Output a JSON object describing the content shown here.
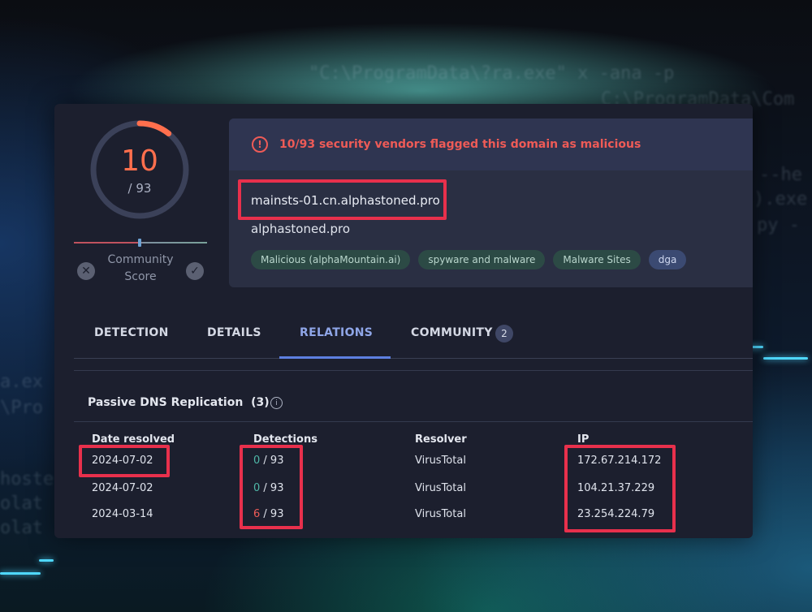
{
  "score": {
    "detected": "10",
    "total_label": "/ 93",
    "detected_count": 10,
    "total_count": 93
  },
  "community": {
    "label_line1": "Community",
    "label_line2": "Score",
    "negative_icon": "close-icon",
    "positive_icon": "check-icon"
  },
  "alert": {
    "icon": "alert-circle-icon",
    "text": "10/93 security vendors flagged this domain as malicious"
  },
  "domain": {
    "name": "mainsts-01.cn.alphastoned.pro",
    "parent": "alphastoned.pro"
  },
  "tags": [
    {
      "label": "Malicious (alphaMountain.ai)"
    },
    {
      "label": "spyware and malware"
    },
    {
      "label": "Malware Sites"
    },
    {
      "label": "dga"
    }
  ],
  "tabs": [
    {
      "label": "DETECTION"
    },
    {
      "label": "DETAILS"
    },
    {
      "label": "RELATIONS"
    },
    {
      "label": "COMMUNITY",
      "badge": "2"
    }
  ],
  "active_tab": "RELATIONS",
  "passive_dns": {
    "title": "Passive DNS Replication",
    "count": "(3)",
    "columns": [
      "Date resolved",
      "Detections",
      "Resolver",
      "IP"
    ],
    "rows": [
      {
        "date": "2024-07-02",
        "det": "0",
        "det_total": "/ 93",
        "resolver": "VirusTotal",
        "ip": "172.67.214.172"
      },
      {
        "date": "2024-07-02",
        "det": "0",
        "det_total": "/ 93",
        "resolver": "VirusTotal",
        "ip": "104.21.37.229"
      },
      {
        "date": "2024-03-14",
        "det": "6",
        "det_total": "/ 93",
        "resolver": "VirusTotal",
        "ip": "23.254.224.79"
      }
    ]
  },
  "background": {
    "code_line1": "\"C:\\ProgramData\\?ra.exe\" x -ana -p",
    "code_line2": "C:\\ProgramData\\Com",
    "code_line3": "--he",
    "code_line4": ").exe",
    "code_line5": "py -",
    "code_line6": "a.ex",
    "code_line7": "\\Pro",
    "code_line8": "hoste",
    "code_line9": "olat",
    "code_line10": "olat"
  },
  "colors": {
    "accent_red": "#ee5b57",
    "highlight": "#e8304c",
    "active_tab": "#8fa6e8",
    "detection_clean": "#4fb8a8"
  }
}
